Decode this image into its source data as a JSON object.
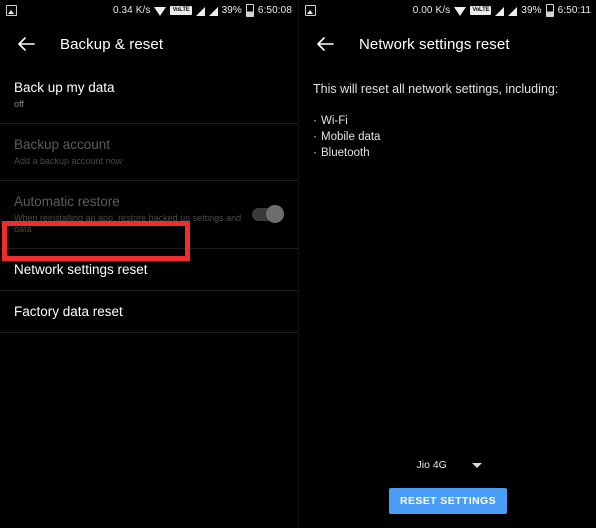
{
  "left": {
    "status_bar": {
      "notification_icon": "image-notification-icon",
      "network_speed": "0.34 K/s",
      "wifi_icon": "wifi-icon",
      "volte_label": "VoLTE",
      "signal_icon_1": "signal-bars-icon",
      "signal_icon_2": "signal-bars-icon",
      "battery_percent": "39%",
      "battery_icon": "battery-icon",
      "clock": "6:50:08"
    },
    "appbar": {
      "back_icon": "back-arrow-icon",
      "title": "Backup & reset"
    },
    "rows": [
      {
        "title": "Back up my data",
        "subtitle": "off",
        "disabled": false,
        "toggle": false
      },
      {
        "title": "Backup account",
        "subtitle": "Add a backup account now",
        "disabled": true,
        "toggle": false
      },
      {
        "title": "Automatic restore",
        "subtitle": "When reinstalling an app, restore backed up settings and data",
        "disabled": true,
        "toggle": true
      },
      {
        "title": "Network settings reset",
        "subtitle": "",
        "disabled": false,
        "toggle": false
      },
      {
        "title": "Factory data reset",
        "subtitle": "",
        "disabled": false,
        "toggle": false
      }
    ]
  },
  "right": {
    "status_bar": {
      "notification_icon": "image-notification-icon",
      "network_speed": "0.00 K/s",
      "wifi_icon": "wifi-icon",
      "volte_label": "VoLTE",
      "signal_icon_1": "signal-bars-icon",
      "signal_icon_2": "signal-bars-icon",
      "battery_percent": "39%",
      "battery_icon": "battery-icon",
      "clock": "6:50:11"
    },
    "appbar": {
      "back_icon": "back-arrow-icon",
      "title": "Network settings reset"
    },
    "description": "This will reset all network settings, including:",
    "bullets": [
      "Wi-Fi",
      "Mobile data",
      "Bluetooth"
    ],
    "sim_select": {
      "value": "Jio 4G",
      "caret_icon": "chevron-down-icon"
    },
    "reset_button": "RESET SETTINGS"
  },
  "annotations": {
    "highlight_color": "#ef2d2d",
    "boxes": [
      "network-settings-reset-row",
      "sim-select-dropdown"
    ]
  },
  "colors": {
    "background": "#000000",
    "divider": "#1f1f1f",
    "primary_text": "#ffffff",
    "secondary_text": "#8a8a8a",
    "disabled_text": "#5c5c5c",
    "accent_button": "#4a9df5",
    "highlight": "#ef2d2d"
  }
}
